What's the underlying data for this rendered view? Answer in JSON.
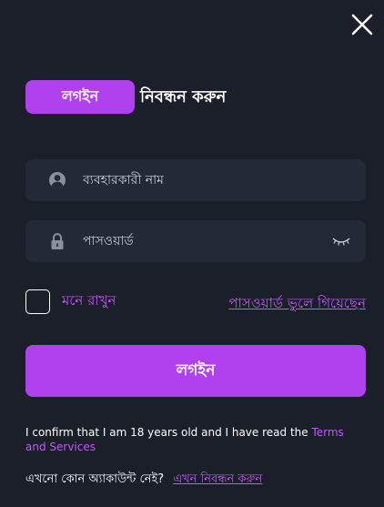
{
  "colors": {
    "background": "#1b1f29",
    "field": "#232937",
    "accent": "#b140ee",
    "link": "#c15af5"
  },
  "icons": {
    "close": "close-icon",
    "user": "user-icon",
    "lock": "lock-icon",
    "eye": "eye-closed-icon"
  },
  "tabs": {
    "login": "লগইন",
    "register": "নিবন্ধন করুন"
  },
  "form": {
    "username_placeholder": "ব্যবহারকারী নাম",
    "password_placeholder": "পাসওয়ার্ড",
    "remember_me": "মনে রাখুন",
    "forgot_password": "পাসওয়ার্ড ভুলে গিয়েছেন",
    "login_button": "লগইন"
  },
  "terms": {
    "text": "I confirm that I am 18 years old and I have read the ",
    "link": "Terms and Services"
  },
  "signup": {
    "prompt": "এখনো কোন অ্যাকাউন্ট নেই?",
    "link": "এখন নিবন্ধন করুন"
  }
}
